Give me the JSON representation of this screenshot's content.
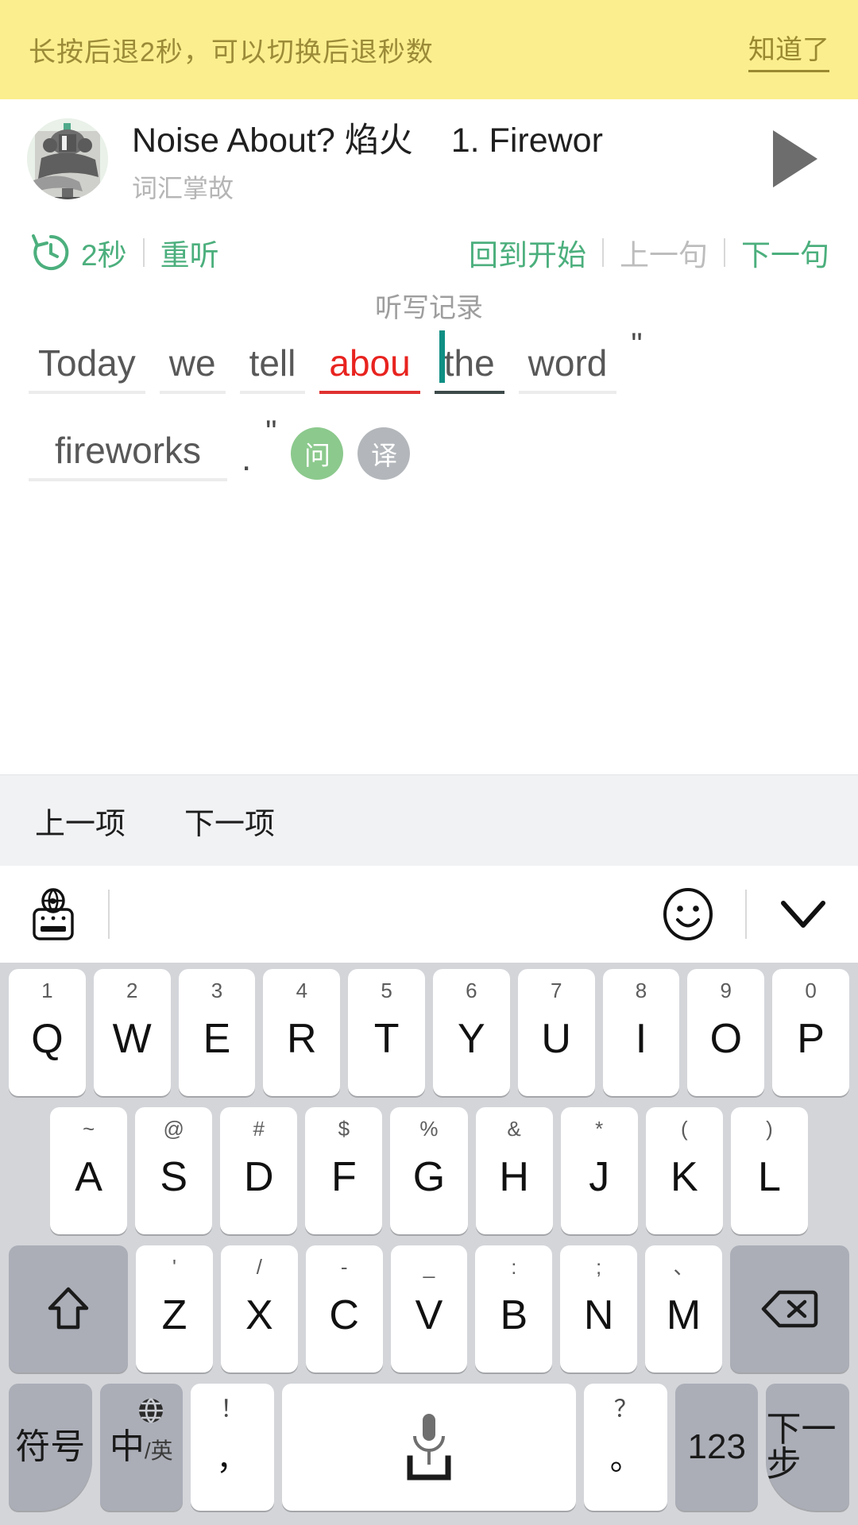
{
  "tip_banner": {
    "message": "长按后退2秒，可以切换后退秒数",
    "action_label": "知道了",
    "bg_color": "#FBEE8E",
    "text_color": "#9B8B38"
  },
  "track": {
    "title": "Noise About? 焰火",
    "episode": "1. Firewor",
    "subtitle": "词汇掌故",
    "avatar_name": "podcast-avatar",
    "play_icon": "play-triangle-icon"
  },
  "controls": {
    "rewind_icon": "rewind-clock-icon",
    "rewind_seconds": "2秒",
    "replay_label": "重听",
    "back_to_start_label": "回到开始",
    "previous_sentence_label": "上一句",
    "next_sentence_label": "下一句",
    "accent_color": "#4CAF7D",
    "disabled_color": "#bdbdbd"
  },
  "dictation": {
    "section_label": "听写记录",
    "tokens": [
      {
        "type": "blank",
        "text": "Today",
        "state": "normal"
      },
      {
        "type": "blank",
        "text": "we",
        "state": "normal"
      },
      {
        "type": "blank",
        "text": "tell",
        "state": "normal"
      },
      {
        "type": "blank",
        "text": "abou",
        "state": "wrong"
      },
      {
        "type": "blank",
        "text": "the",
        "state": "active"
      },
      {
        "type": "blank",
        "text": "word",
        "state": "normal"
      },
      {
        "type": "punct",
        "text": "\""
      },
      {
        "type": "blank",
        "text": "fireworks",
        "state": "normal"
      },
      {
        "type": "punct",
        "text": "."
      },
      {
        "type": "punct",
        "text": "\""
      },
      {
        "type": "pill",
        "text": "问",
        "style": "ask"
      },
      {
        "type": "pill",
        "text": "译",
        "style": "trans"
      }
    ],
    "wrong_color": "#e8231f",
    "caret_color": "#0f8f84",
    "pill_ask_color": "#8CC98D",
    "pill_trans_color": "#b3b7bb"
  },
  "ime_nav": {
    "previous_label": "上一项",
    "next_label": "下一项"
  },
  "keyboard_toolbar": {
    "language_icon": "globe-keyboard-icon",
    "emoji_icon": "smiley-face-icon",
    "collapse_icon": "chevron-down-icon"
  },
  "keyboard": {
    "bg_color": "#D3D5D9",
    "key_color": "#ffffff",
    "fn_key_color": "#ABAEB7",
    "row1": [
      {
        "sup": "1",
        "main": "Q"
      },
      {
        "sup": "2",
        "main": "W"
      },
      {
        "sup": "3",
        "main": "E"
      },
      {
        "sup": "4",
        "main": "R"
      },
      {
        "sup": "5",
        "main": "T"
      },
      {
        "sup": "6",
        "main": "Y"
      },
      {
        "sup": "7",
        "main": "U"
      },
      {
        "sup": "8",
        "main": "I"
      },
      {
        "sup": "9",
        "main": "O"
      },
      {
        "sup": "0",
        "main": "P"
      }
    ],
    "row2": [
      {
        "sup": "~",
        "main": "A"
      },
      {
        "sup": "@",
        "main": "S"
      },
      {
        "sup": "#",
        "main": "D"
      },
      {
        "sup": "$",
        "main": "F"
      },
      {
        "sup": "%",
        "main": "G"
      },
      {
        "sup": "&",
        "main": "H"
      },
      {
        "sup": "*",
        "main": "J"
      },
      {
        "sup": "(",
        "main": "K"
      },
      {
        "sup": ")",
        "main": "L"
      }
    ],
    "row3": [
      {
        "sup": "'",
        "main": "Z"
      },
      {
        "sup": "/",
        "main": "X"
      },
      {
        "sup": "-",
        "main": "C"
      },
      {
        "sup": "_",
        "main": "V"
      },
      {
        "sup": ":",
        "main": "B"
      },
      {
        "sup": ";",
        "main": "N"
      },
      {
        "sup": "、",
        "main": "M"
      }
    ],
    "shift_icon": "shift-arrow-icon",
    "backspace_icon": "backspace-delete-icon",
    "row4": {
      "symbol_label": "符号",
      "lang_main": "中",
      "lang_sub": "/英",
      "lang_globe_icon": "globe-icon",
      "comma_sup": "！",
      "comma_main": "，",
      "space_icon": "microphone-icon",
      "space_bar_icon": "space-underline-icon",
      "period_sup": "？",
      "period_main": "。",
      "numeric_label": "123",
      "enter_label": "下一步"
    }
  }
}
